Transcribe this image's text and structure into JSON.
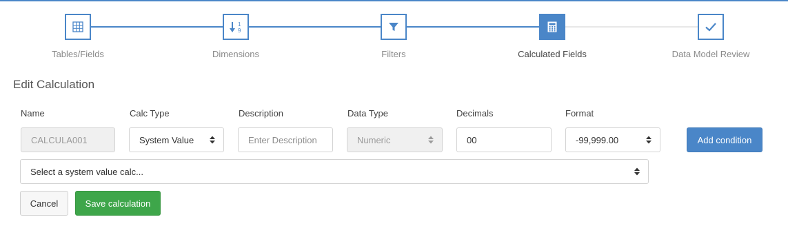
{
  "theme": {
    "accent": "#4a86c8",
    "success": "#3ea64a",
    "inactive_line": "#e8e8e8"
  },
  "stepper": {
    "steps": [
      {
        "label": "Tables/Fields",
        "icon": "table-grid-icon",
        "state": "done"
      },
      {
        "label": "Dimensions",
        "icon": "sort-numeric-icon",
        "state": "done"
      },
      {
        "label": "Filters",
        "icon": "filter-icon",
        "state": "done"
      },
      {
        "label": "Calculated Fields",
        "icon": "calculator-icon",
        "state": "active"
      },
      {
        "label": "Data Model Review",
        "icon": "checkmark-icon",
        "state": "todo"
      }
    ],
    "sort_icon_digits": "1\n9"
  },
  "form": {
    "title": "Edit Calculation",
    "name": {
      "label": "Name",
      "value": "CALCULA001"
    },
    "calc_type": {
      "label": "Calc Type",
      "value": "System Value"
    },
    "description": {
      "label": "Description",
      "placeholder": "Enter Description"
    },
    "data_type": {
      "label": "Data Type",
      "value": "Numeric"
    },
    "decimals": {
      "label": "Decimals",
      "value": "00"
    },
    "format": {
      "label": "Format",
      "value": "-99,999.00"
    },
    "add_condition_label": "Add condition",
    "system_value_select": {
      "value": "Select a system value calc..."
    },
    "cancel_label": "Cancel",
    "save_label": "Save calculation"
  }
}
